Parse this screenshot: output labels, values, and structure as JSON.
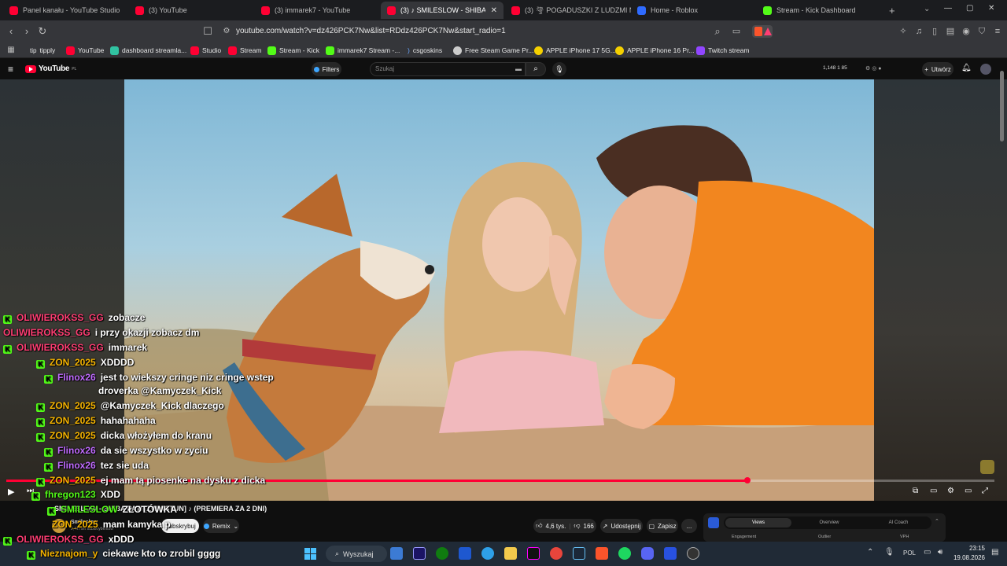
{
  "browser": {
    "tabs": [
      {
        "title": "Panel kanału - YouTube Studio",
        "icon": "yt"
      },
      {
        "title": "(3) YouTube",
        "icon": "yt"
      },
      {
        "title": "(3) immarek7 - YouTube",
        "icon": "yt"
      },
      {
        "title": "(3) ♪ SMILESLOW - SHIBA🐶 fe",
        "icon": "yt",
        "active": true
      },
      {
        "title": "(3) 🌪 POGADUSZKI Z LUDZMI NA",
        "icon": "yt"
      },
      {
        "title": "Home - Roblox",
        "icon": "rb"
      },
      {
        "title": "Stream - Kick Dashboard",
        "icon": "kick"
      }
    ],
    "new_tab": "+",
    "url": "youtube.com/watch?v=dz426PCK7Nw&list=RDdz426PCK7Nw&start_radio=1",
    "bookmarks": [
      {
        "label": "tipply",
        "icon": "generic"
      },
      {
        "label": "YouTube",
        "icon": "yt"
      },
      {
        "label": "dashboard streamla...",
        "icon": "generic"
      },
      {
        "label": "Studio",
        "icon": "yt"
      },
      {
        "label": "Stream",
        "icon": "yt"
      },
      {
        "label": "Stream - Kick",
        "icon": "kick"
      },
      {
        "label": "immarek7 Stream -...",
        "icon": "kick"
      },
      {
        "label": "csgoskins",
        "icon": "generic"
      },
      {
        "label": "Free Steam Game Pr...",
        "icon": "generic"
      },
      {
        "label": "APPLE iPhone 17 5G...",
        "icon": "generic"
      },
      {
        "label": "APPLE iPhone 16 Pr...",
        "icon": "generic"
      },
      {
        "label": "Twitch stream",
        "icon": "generic"
      }
    ]
  },
  "youtube": {
    "logo": "YouTube",
    "logo_sup": "PL",
    "filters": "Filters",
    "search_placeholder": "Szukaj",
    "stats": "1,148  1  85",
    "create": "Utwórz"
  },
  "chat": [
    {
      "user": "OLIWIEROKSS_GG",
      "color": "#ff3d73",
      "msg": "zobacze",
      "badge": true
    },
    {
      "user": "OLIWIEROKSS_GG",
      "color": "#ff3d73",
      "msg": "i przy okazji zobacz dm",
      "badge": false
    },
    {
      "user": "OLIWIEROKSS_GG",
      "color": "#ff3d73",
      "msg": "immarek",
      "badge": true
    },
    {
      "user": "ZON_2025",
      "color": "#f5b400",
      "msg": "XDDDD",
      "badge": true
    },
    {
      "user": "Flinox26",
      "color": "#c06bff",
      "msg": "jest to wiekszy cringe niz cringe wstep",
      "badge": true
    },
    {
      "user": "",
      "color": "#ffffff",
      "msg": "droverka @Kamyczek_Kick",
      "badge": false
    },
    {
      "user": "ZON_2025",
      "color": "#f5b400",
      "msg": "@Kamyczek_Kick dlaczego",
      "badge": true
    },
    {
      "user": "ZON_2025",
      "color": "#f5b400",
      "msg": "hahahahaha",
      "badge": true
    },
    {
      "user": "ZON_2025",
      "color": "#f5b400",
      "msg": "dicka włożyłem do kranu",
      "badge": true
    },
    {
      "user": "Flinox26",
      "color": "#c06bff",
      "msg": "da sie wszystko w zyciu",
      "badge": true
    },
    {
      "user": "Flinox26",
      "color": "#c06bff",
      "msg": "tez sie uda",
      "badge": true
    },
    {
      "user": "ZON_2025",
      "color": "#f5b400",
      "msg": "ej mam tą piosenke na dysku z dicka",
      "badge": true
    },
    {
      "user": "fhregon123",
      "color": "#53fc18",
      "msg": "XDD",
      "badge": true
    },
    {
      "user": "SMILESLOW",
      "color": "#53fc18",
      "msg": "ZŁOTÓWKA",
      "badge": true
    },
    {
      "user": "ZON_2025",
      "color": "#f5b400",
      "msg": "mam kamyka p",
      "badge": false
    },
    {
      "user": "OLIWIEROKSS_GG",
      "color": "#ff3d73",
      "msg": "xDDD",
      "badge": true
    },
    {
      "user": "Nieznajom_y",
      "color": "#f5b400",
      "msg": "ciekawe kto to zrobil gggg",
      "badge": true
    }
  ],
  "player": {
    "progress": 0.75
  },
  "below_video": {
    "title": "♪ SMILESLOW - SHIBA PATI [ZWIASTUN] ♪ (PREMIERA ZA 2 DNI)",
    "channel": "Smileslow",
    "subs": "2,41 mln subskrybentów",
    "subscribe": "Subskrybuj",
    "remix": "Remix",
    "likes": "4,6 tys.",
    "dislikes": "166",
    "share": "Udostępnij",
    "save": "Zapisz",
    "more": "...",
    "panel_tabs": [
      "Views",
      "Overview",
      "AI Coach"
    ],
    "panel_labels": [
      "Engagement",
      "Outlier",
      "VPH"
    ]
  },
  "taskbar": {
    "search": "Wyszukaj",
    "lang": "POL",
    "time": "23:15",
    "date": "19.08.2026"
  }
}
